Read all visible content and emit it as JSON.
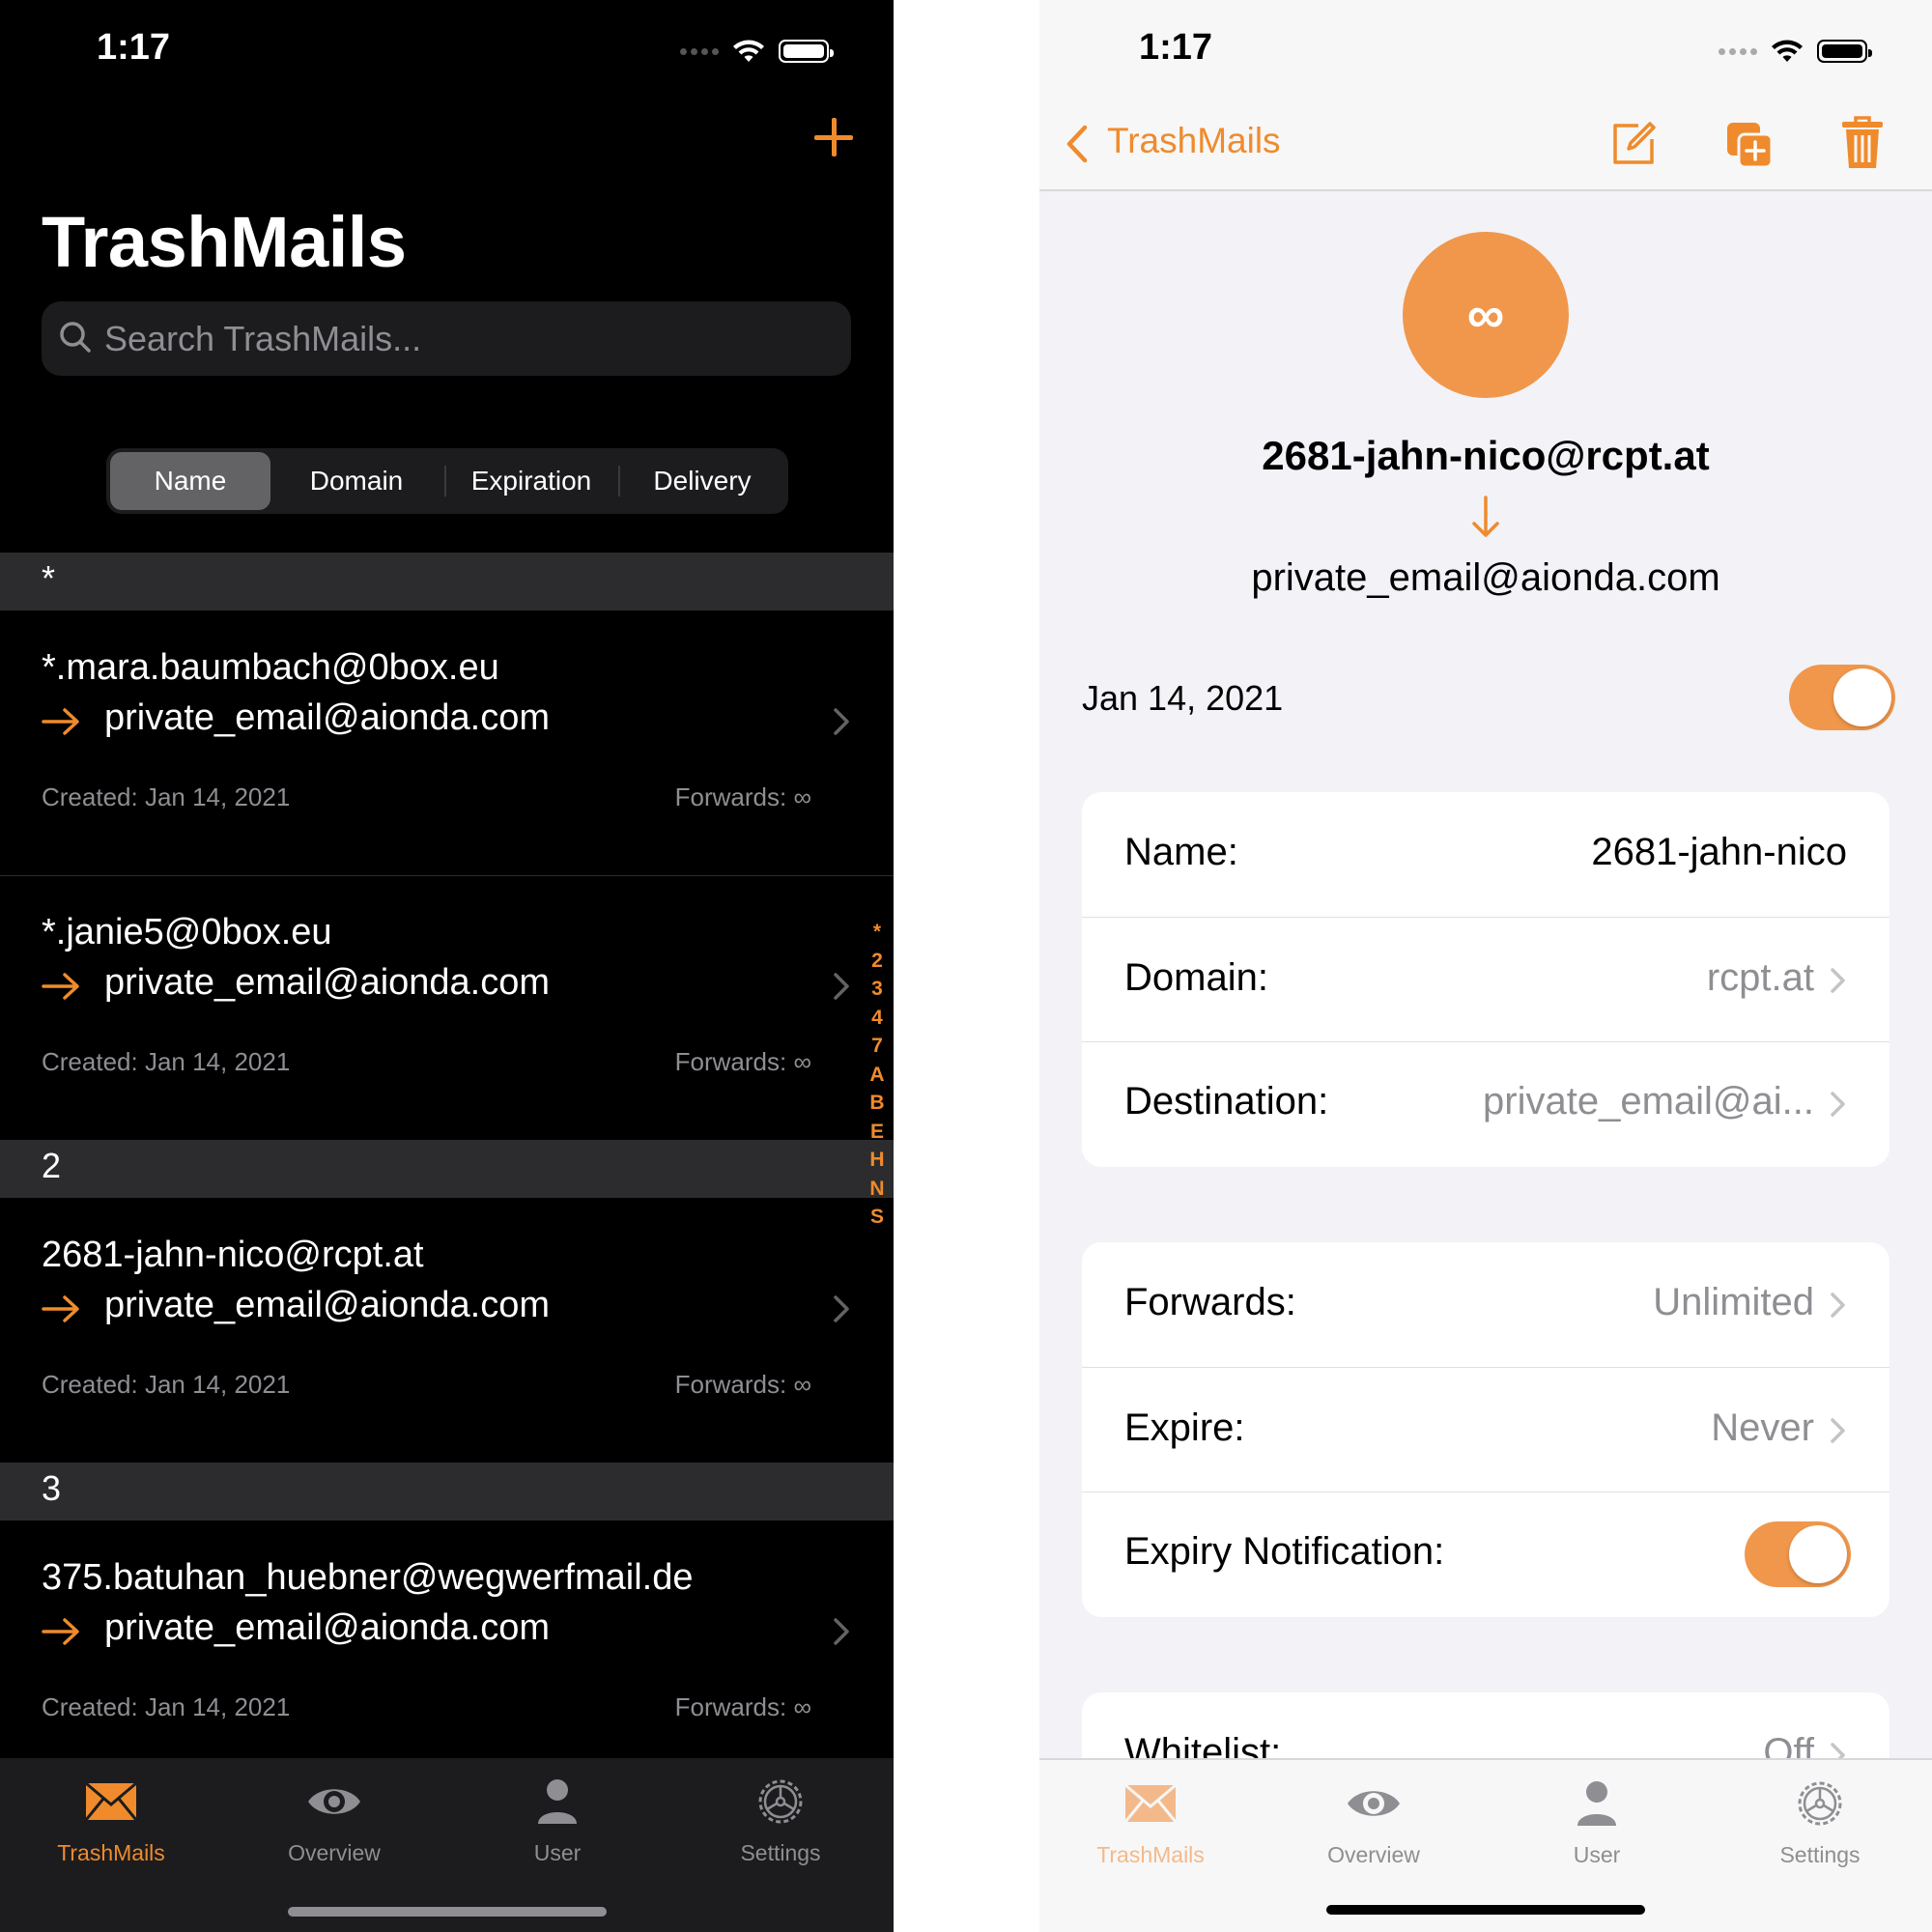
{
  "colors": {
    "accent": "#ef8b2c",
    "avatar": "#f0974b",
    "dark_bg": "#000000",
    "light_bg": "#f2f2f7"
  },
  "left": {
    "status_time": "1:17",
    "title": "TrashMails",
    "search_placeholder": "Search TrashMails...",
    "segments": [
      "Name",
      "Domain",
      "Expiration",
      "Delivery"
    ],
    "selected_segment": "Name",
    "sections": [
      {
        "header": "*",
        "rows": [
          {
            "address": "*.mara.baumbach@0box.eu",
            "destination": "private_email@aionda.com",
            "created": "Created: Jan 14, 2021",
            "forwards": "Forwards: ∞"
          },
          {
            "address": "*.janie5@0box.eu",
            "destination": "private_email@aionda.com",
            "created": "Created: Jan 14, 2021",
            "forwards": "Forwards: ∞"
          }
        ]
      },
      {
        "header": "2",
        "rows": [
          {
            "address": "2681-jahn-nico@rcpt.at",
            "destination": "private_email@aionda.com",
            "created": "Created: Jan 14, 2021",
            "forwards": "Forwards: ∞"
          }
        ]
      },
      {
        "header": "3",
        "rows": [
          {
            "address": "375.batuhan_huebner@wegwerfmail.de",
            "destination": "private_email@aionda.com",
            "created": "Created: Jan 14, 2021",
            "forwards": "Forwards: ∞"
          }
        ]
      }
    ],
    "index_letters": [
      "*",
      "2",
      "3",
      "4",
      "7",
      "A",
      "B",
      "E",
      "H",
      "N",
      "S"
    ],
    "tabs": [
      {
        "label": "TrashMails",
        "icon": "envelope-icon",
        "active": true
      },
      {
        "label": "Overview",
        "icon": "eye-icon",
        "active": false
      },
      {
        "label": "User",
        "icon": "person-icon",
        "active": false
      },
      {
        "label": "Settings",
        "icon": "gear-icon",
        "active": false
      }
    ]
  },
  "right": {
    "status_time": "1:17",
    "back_label": "TrashMails",
    "avatar_symbol": "∞",
    "address": "2681-jahn-nico@rcpt.at",
    "destination": "private_email@aionda.com",
    "date": "Jan 14, 2021",
    "enabled": true,
    "card1": [
      {
        "key": "Name:",
        "value": "2681-jahn-nico"
      },
      {
        "key": "Domain:",
        "value": "rcpt.at"
      },
      {
        "key": "Destination:",
        "value": "private_email@ai..."
      }
    ],
    "card2": [
      {
        "key": "Forwards:",
        "value": "Unlimited"
      },
      {
        "key": "Expire:",
        "value": "Never"
      },
      {
        "key": "Expiry Notification:",
        "toggle": true
      }
    ],
    "card3": [
      {
        "key": "Whitelist:",
        "value": "Off"
      }
    ],
    "tabs": [
      {
        "label": "TrashMails",
        "icon": "envelope-icon",
        "active": true
      },
      {
        "label": "Overview",
        "icon": "eye-icon",
        "active": false
      },
      {
        "label": "User",
        "icon": "person-icon",
        "active": false
      },
      {
        "label": "Settings",
        "icon": "gear-icon",
        "active": false
      }
    ]
  }
}
